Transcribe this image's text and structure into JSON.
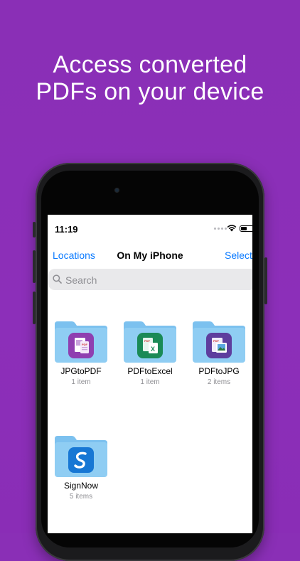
{
  "headline": {
    "line1": "Access converted",
    "line2": "PDFs on your device"
  },
  "status_bar": {
    "time": "11:19"
  },
  "nav": {
    "back_label": "Locations",
    "title": "On My iPhone",
    "action_label": "Select"
  },
  "search": {
    "placeholder": "Search",
    "value": ""
  },
  "folders": [
    {
      "name": "JPGtoPDF",
      "count": "1 item",
      "badge_color": "#8f3fb0",
      "icon": "jpg-to-pdf-app-icon"
    },
    {
      "name": "PDFtoExcel",
      "count": "1 item",
      "badge_color": "#1a8a56",
      "icon": "pdf-to-excel-app-icon"
    },
    {
      "name": "PDFtoJPG",
      "count": "2 items",
      "badge_color": "#5e3d9e",
      "icon": "pdf-to-jpg-app-icon"
    },
    {
      "name": "SignNow",
      "count": "5 items",
      "badge_color": "#1777d4",
      "icon": "signnow-app-icon"
    }
  ],
  "colors": {
    "background": "#8a2fb6",
    "ios_blue": "#0a7aff",
    "folder_blue": "#8fcdf3"
  }
}
